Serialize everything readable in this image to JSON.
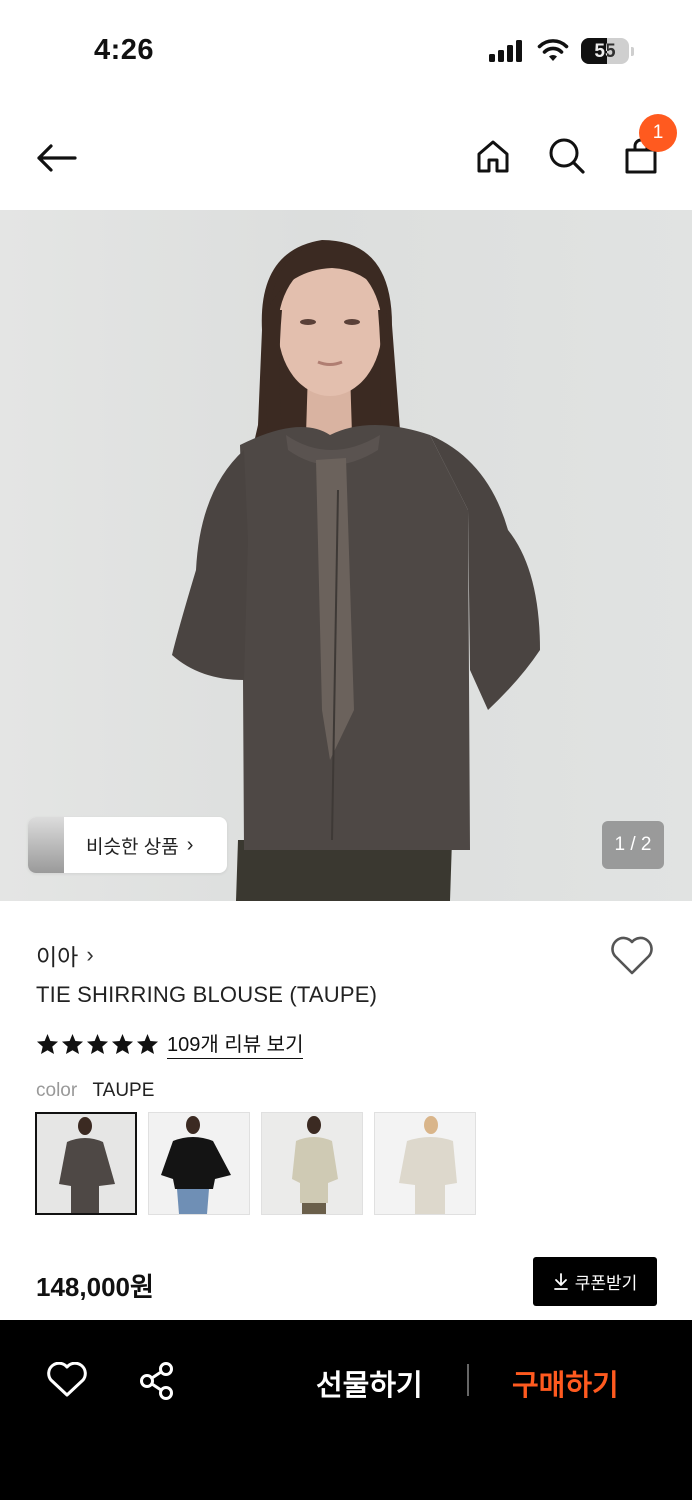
{
  "status_bar": {
    "time": "4:26",
    "battery": "55"
  },
  "header": {
    "cart_count": "1"
  },
  "hero": {
    "similar_label": "비슷한 상품",
    "page_indicator": "1 / 2"
  },
  "product": {
    "brand": "이아",
    "name": "TIE SHIRRING BLOUSE (TAUPE)",
    "rating_stars": 5,
    "review_link": "109개 리뷰 보기",
    "color_label": "color",
    "color_value": "TAUPE",
    "swatch_colors": [
      "TAUPE",
      "BLACK",
      "BEIGE",
      "IVORY"
    ],
    "price": "148,000원"
  },
  "coupon": {
    "label": "쿠폰받기"
  },
  "bottom_bar": {
    "gift_label": "선물하기",
    "buy_label": "구매하기"
  },
  "colors": {
    "accent": "#ff5a1f",
    "bar": "#000000"
  }
}
